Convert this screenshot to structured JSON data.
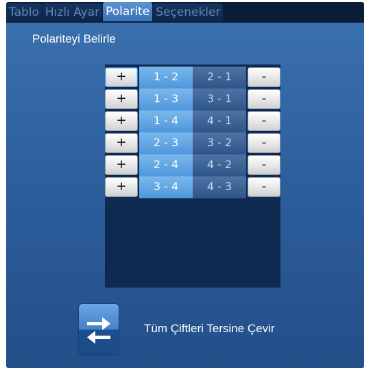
{
  "tabs": [
    {
      "label": "Tablo",
      "active": false
    },
    {
      "label": "Hızlı Ayar",
      "active": false
    },
    {
      "label": "Polarite",
      "active": true
    },
    {
      "label": "Seçenekler",
      "active": false
    }
  ],
  "panel": {
    "title": "Polariteyi Belirle",
    "plus_label": "+",
    "minus_label": "-",
    "pairs": [
      {
        "forward": "1 - 2",
        "reverse": "2 - 1"
      },
      {
        "forward": "1 - 3",
        "reverse": "3 - 1"
      },
      {
        "forward": "1 - 4",
        "reverse": "4 - 1"
      },
      {
        "forward": "2 - 3",
        "reverse": "3 - 2"
      },
      {
        "forward": "2 - 4",
        "reverse": "4 - 2"
      },
      {
        "forward": "3 - 4",
        "reverse": "4 - 3"
      }
    ],
    "reverse_all_label": "Tüm Çiftleri Tersine Çevir"
  },
  "colors": {
    "window_bg": "#0a1c38",
    "panel_bg": "#2c5d9b",
    "tab_active": "#4a84c8",
    "tab_inactive_text": "#5f86b4",
    "forward_cell": "#5aa2e2",
    "reverse_cell": "#3a6296",
    "list_bg": "#0e2a50"
  },
  "icons": {
    "reverse_all": "swap-arrows-icon"
  }
}
